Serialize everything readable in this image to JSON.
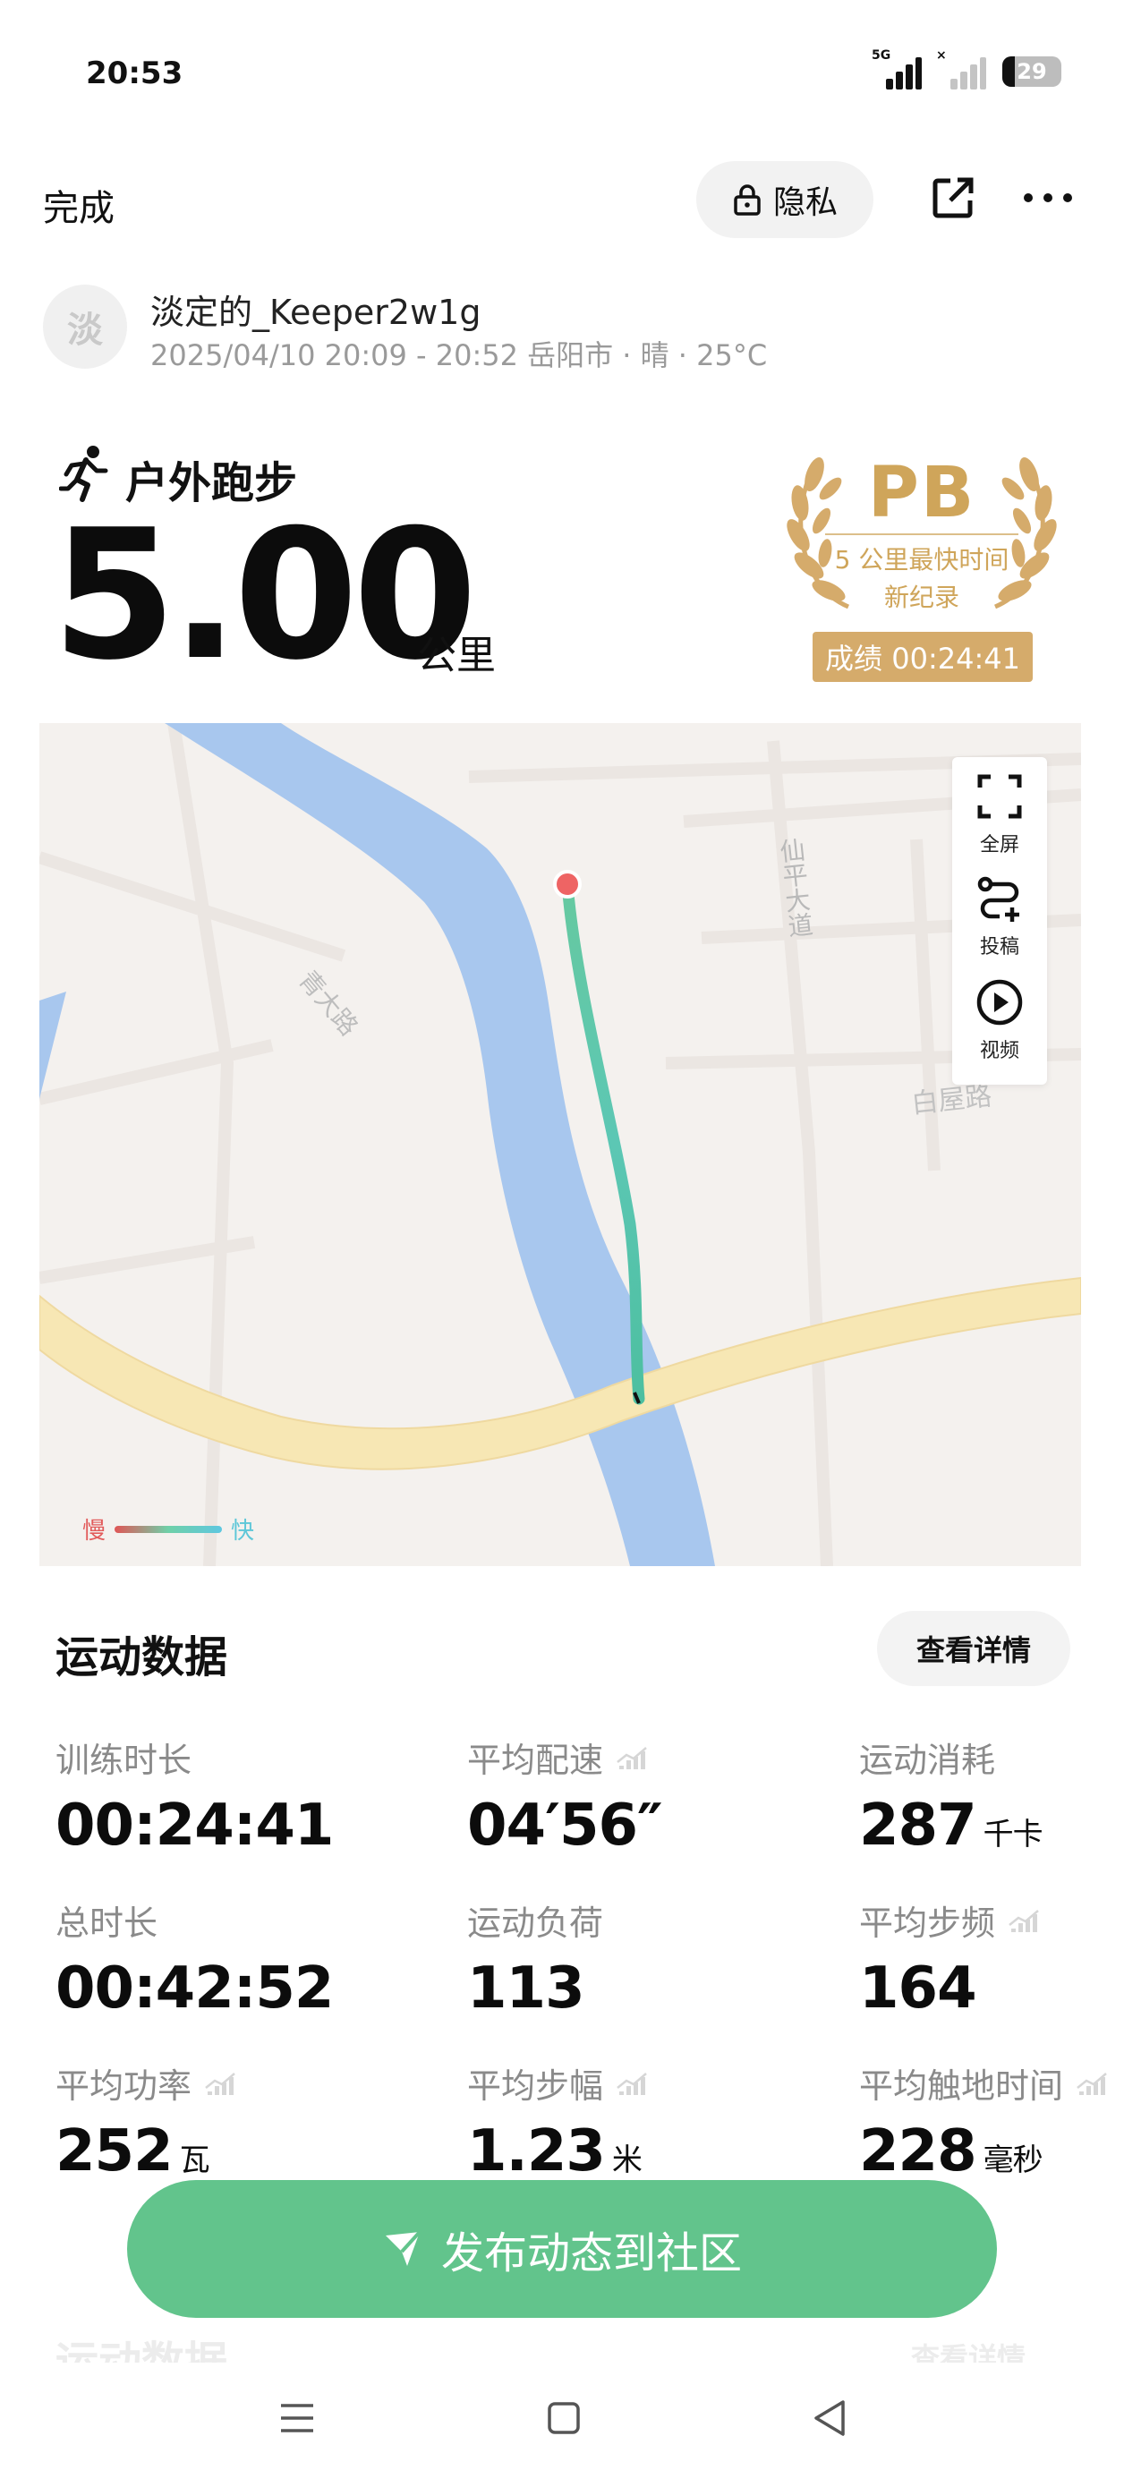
{
  "status_bar": {
    "time": "20:53",
    "network": "5G",
    "battery": "29"
  },
  "top_bar": {
    "done_label": "完成",
    "privacy_label": "隐私"
  },
  "user": {
    "avatar_char": "淡",
    "name": "淡定的_Keeper2w1g",
    "meta": "2025/04/10 20:09 - 20:52 岳阳市 · 晴 · 25°C"
  },
  "activity": {
    "title": "户外跑步",
    "distance": "5.00",
    "unit": "公里"
  },
  "pb_badge": {
    "title": "PB",
    "line1": "5 公里最快时间",
    "line2": "新纪录",
    "score": "成绩 00:24:41",
    "color": "#cfa55a"
  },
  "map": {
    "road_labels": [
      "仙平大道",
      "白屋路",
      "青大路"
    ],
    "tools": [
      {
        "icon": "fullscreen-icon",
        "label": "全屏"
      },
      {
        "icon": "route-post-icon",
        "label": "投稿"
      },
      {
        "icon": "play-icon",
        "label": "视频"
      }
    ],
    "legend_slow": "慢",
    "legend_fast": "快"
  },
  "stats_section": {
    "title": "运动数据",
    "details_label": "查看详情",
    "items": [
      {
        "label": "训练时长",
        "value": "00:24:41",
        "unit": ""
      },
      {
        "label": "平均配速",
        "value": "04′56″",
        "unit": ""
      },
      {
        "label": "运动消耗",
        "value": "287",
        "unit": "千卡"
      },
      {
        "label": "总时长",
        "value": "00:42:52",
        "unit": ""
      },
      {
        "label": "运动负荷",
        "value": "113",
        "unit": ""
      },
      {
        "label": "平均步频",
        "value": "164",
        "unit": ""
      },
      {
        "label": "平均功率",
        "value": "252",
        "unit": "瓦"
      },
      {
        "label": "平均步幅",
        "value": "1.23",
        "unit": "米"
      },
      {
        "label": "平均触地时间",
        "value": "228",
        "unit": "毫秒"
      }
    ]
  },
  "publish": {
    "label": "发布动态到社区",
    "color": "#62c48c"
  },
  "ghost": {
    "title": "运动数据",
    "details": "查看详情"
  }
}
